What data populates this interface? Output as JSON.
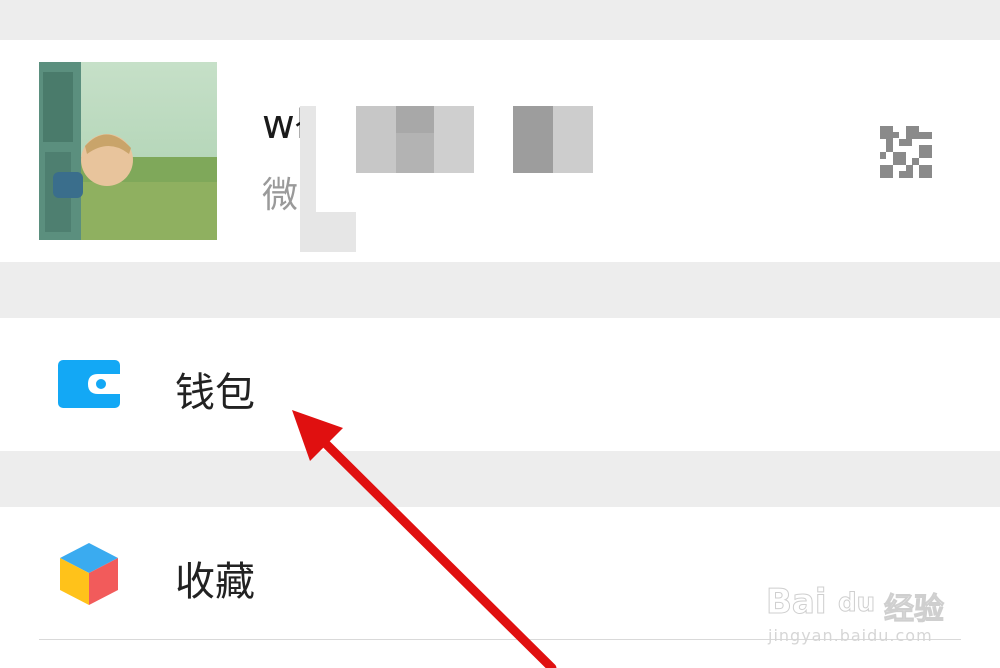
{
  "profile": {
    "name": "wł",
    "wechat_id_prefix": "微",
    "avatar_icon": "avatar-photo",
    "qr_icon": "qr-code-icon"
  },
  "menu": {
    "wallet": {
      "label": "钱包",
      "icon": "wallet-icon",
      "icon_color": "#13a8f5"
    },
    "favorites": {
      "label": "收藏",
      "icon": "favorites-cube-icon"
    }
  },
  "watermark": {
    "brand": "Bai",
    "brand_paw": "du",
    "suffix": "经验",
    "url": "jingyan.baidu.com"
  },
  "colors": {
    "background": "#ededed",
    "arrow": "#e01010"
  }
}
